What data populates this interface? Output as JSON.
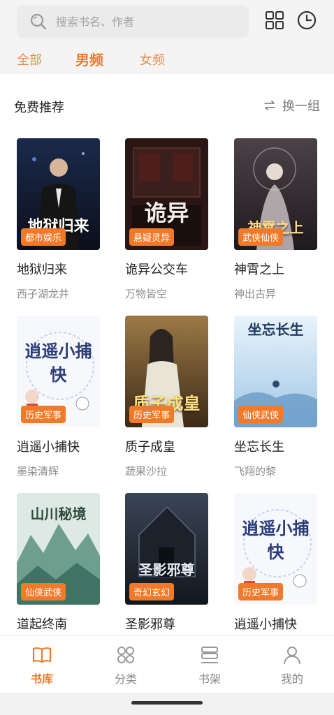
{
  "search": {
    "placeholder": "搜索书名、作者"
  },
  "header_icons": [
    "grid-icon",
    "history-clock-icon"
  ],
  "tabs": [
    {
      "label": "全部",
      "active": false
    },
    {
      "label": "男频",
      "active": true
    },
    {
      "label": "女频",
      "active": false
    }
  ],
  "section": {
    "title": "免费推荐",
    "refresh_label": "换一组"
  },
  "books": [
    {
      "title": "地狱归来",
      "author": "西子湖龙井",
      "genre": "都市娱乐",
      "cover_text": "地狱归来"
    },
    {
      "title": "诡异公交车",
      "author": "万物皆空",
      "genre": "悬疑灵异",
      "cover_text": "诡异"
    },
    {
      "title": "神霄之上",
      "author": "神出古异",
      "genre": "武侠仙侠",
      "cover_text": "神霄之上"
    },
    {
      "title": "逍遥小捕快",
      "author": "墨染清辉",
      "genre": "历史军事",
      "cover_text": "逍遥小捕快"
    },
    {
      "title": "质子成皇",
      "author": "蔬果沙拉",
      "genre": "历史军事",
      "cover_text": "质子成皇"
    },
    {
      "title": "坐忘长生",
      "author": "飞翔的黎",
      "genre": "仙侠武侠",
      "cover_text": "坐忘长生"
    },
    {
      "title": "道起终南",
      "author": "",
      "genre": "仙侠武侠",
      "cover_text": "山川秘境"
    },
    {
      "title": "圣影邪尊",
      "author": "",
      "genre": "奇幻玄幻",
      "cover_text": "圣影邪尊"
    },
    {
      "title": "逍遥小捕快",
      "author": "",
      "genre": "历史军事",
      "cover_text": "逍遥小捕快"
    }
  ],
  "nav": [
    {
      "label": "书库",
      "icon": "open-book-icon",
      "active": true
    },
    {
      "label": "分类",
      "icon": "category-circles-icon",
      "active": false
    },
    {
      "label": "书架",
      "icon": "bookshelf-icon",
      "active": false
    },
    {
      "label": "我的",
      "icon": "person-icon",
      "active": false
    }
  ],
  "colors": {
    "accent": "#f07a2a",
    "background": "#f4f4f4"
  }
}
